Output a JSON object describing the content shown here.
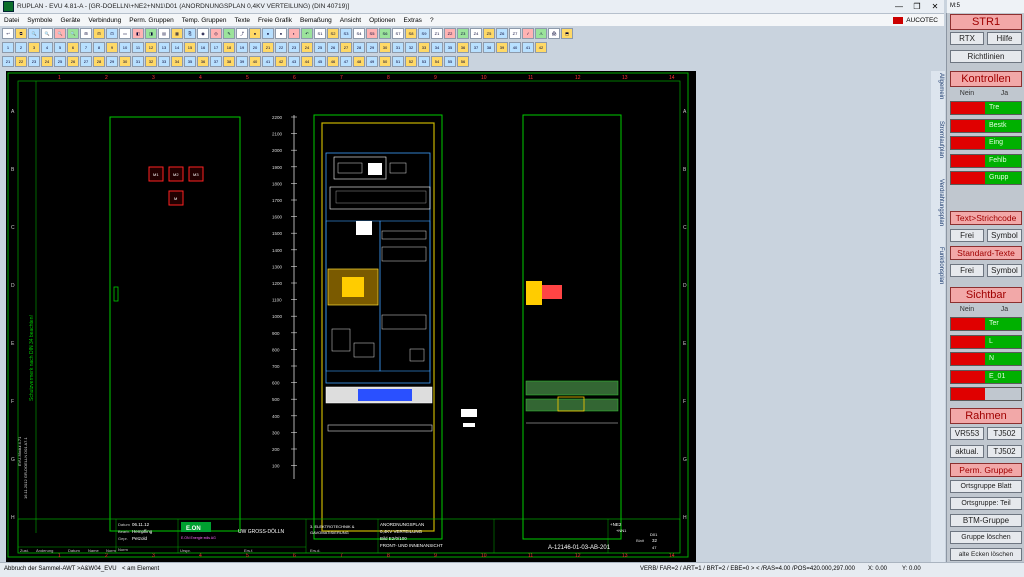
{
  "window": {
    "title": "RUPLAN - EVU 4.81-A - [GR-DOELLN\\+NE2+NN1\\D01 (ANORDNUNGSPLAN 0,4KV VERTEILUNG) (DIN 40719)]",
    "controls": [
      "—",
      "❐",
      "✕"
    ]
  },
  "menu": {
    "items": [
      "Datei",
      "Symbole",
      "Geräte",
      "Verbindung",
      "Perm. Gruppen",
      "Temp. Gruppen",
      "Texte",
      "Freie Grafik",
      "Bemaßung",
      "Ansicht",
      "Optionen",
      "Extras",
      "?"
    ],
    "brand": "AUCOTEC",
    "brand_color": "#cc0000"
  },
  "toolbar_rows": {
    "row1": [
      "↩",
      "⧉",
      "🔍",
      "🔍",
      "🔍",
      "🔍",
      "⊞",
      "⊟",
      "⊡",
      "▭",
      "◧",
      "◨",
      "▤",
      "▦",
      "⎘",
      "◉",
      "◎",
      "✎",
      "⤴",
      "●",
      "●",
      "●",
      "◐",
      "↶",
      "S1",
      "S2",
      "S3",
      "S4",
      "S5",
      "S6",
      "S7",
      "S8",
      "S9",
      "Z1",
      "Z2",
      "Z3",
      "Z4",
      "Z5",
      "Z6",
      "Z7",
      "✓",
      "⚠",
      "🖨",
      "⬒"
    ],
    "row2": [
      "1",
      "2",
      "3",
      "4",
      "5",
      "6",
      "7",
      "8",
      "9",
      "10",
      "11",
      "12",
      "13",
      "14",
      "15",
      "16",
      "17",
      "18",
      "19",
      "20",
      "21",
      "22",
      "23",
      "24",
      "25",
      "26",
      "27",
      "28",
      "29",
      "30",
      "31",
      "32",
      "33",
      "34",
      "35",
      "36",
      "37",
      "38",
      "39",
      "40",
      "41",
      "42"
    ],
    "row3": [
      "21",
      "22",
      "23",
      "24",
      "25",
      "26",
      "27",
      "28",
      "29",
      "30",
      "31",
      "32",
      "33",
      "34",
      "35",
      "36",
      "37",
      "38",
      "39",
      "40",
      "41",
      "42",
      "43",
      "44",
      "45",
      "46",
      "47",
      "48",
      "49",
      "50",
      "51",
      "52",
      "53",
      "54",
      "55",
      "56"
    ],
    "row4": [
      "1",
      "2",
      "3",
      "4",
      "5",
      "6",
      "7",
      "8",
      "9",
      "10",
      "11",
      "12",
      "13",
      "14",
      "15",
      "16",
      "17",
      "18",
      "19",
      "20",
      "21",
      "22",
      "23",
      "24",
      "25",
      "26",
      "27",
      "28",
      "29",
      "30",
      "31",
      "32",
      "33",
      "34",
      "35",
      "36",
      "37"
    ]
  },
  "drawing": {
    "background": "#000000",
    "frame_color": "#00aa00",
    "column_labels": [
      "1",
      "2",
      "3",
      "4",
      "5",
      "6",
      "7",
      "8",
      "9",
      "10",
      "11",
      "12",
      "13",
      "14"
    ],
    "row_labels": [
      "A",
      "B",
      "C",
      "D",
      "E",
      "F",
      "G",
      "H"
    ],
    "scale_labels": [
      "2200",
      "2100",
      "2000",
      "1900",
      "1800",
      "1700",
      "1600",
      "1500",
      "1400",
      "1300",
      "1200",
      "1100",
      "1000",
      "900",
      "800",
      "700",
      "600",
      "500",
      "400",
      "300",
      "200",
      "100"
    ],
    "left_vertical_text": "Schutzvermerk nach DIN 34 beachten!",
    "left_small_text": "EVU-Modul 4.71",
    "left_date_text": "16.11.2012 GR-DOELLN D01 A7.1",
    "device_labels": [
      "M1",
      "M2",
      "M3",
      "M"
    ],
    "title_block": {
      "datum_label": "Datum",
      "datum_value": "06.11.12",
      "bearb_label": "Bearb.",
      "bearb_value": "Hempfling",
      "gepr_label": "Gepr.",
      "gepr_value": "Petzold",
      "norm_label": "Norm",
      "company_logo": "E.ON",
      "company_sub": "E.ON Energie edis AG",
      "project": "UW GROSS-DÖLLN",
      "dept_line1": "3. ELEKTROTECHNIK &",
      "dept_line2": "GAVOMATISIERUNG",
      "doc_line1": "ANORDNUNGSPLAN",
      "doc_line2": "0,4KV VERTEILUNG",
      "doc_line3": "Bild E2/0/100",
      "doc_line4": "FRONT- UND INNENANSICHT",
      "ref1": "+NE2",
      "ref2": "+NN1",
      "ref3": "D01",
      "sheet_label": "Blatt",
      "sheet_value": "32",
      "sheets": "47",
      "drawing_no": "A-12146-01-03-AB-201",
      "zust": "Zust.",
      "aenderung": "Änderung",
      "datum": "Datum",
      "name": "Name",
      "norm": "Norm",
      "urspr": "Urspr.",
      "ers_f": "Ers.f.",
      "ers_d": "Ers.d."
    }
  },
  "side_tabs": [
    "Allgemein",
    "Stromlaufplan",
    "Verdrahtungsplan",
    "Funktionsplan"
  ],
  "right_panel": {
    "window_label": "M:5",
    "title": "STR1",
    "btn_rtx": "RTX",
    "btn_hilfe": "Hilfe",
    "btn_richtlinien": "Richtlinien",
    "kontrollen": "Kontrollen",
    "nein": "Nein",
    "ja": "Ja",
    "kontrollen_items": [
      "Tre",
      "Bestk",
      "Eing",
      "Fehlb",
      "Grupp"
    ],
    "text_strichcode": "Text>Strichcode",
    "frei": "Frei",
    "symbol": "Symbol",
    "standard_texte": "Standard-Texte",
    "sichtbar": "Sichtbar",
    "sichtbar_items": [
      "Ter",
      "L",
      "N",
      "E_01",
      ""
    ],
    "rahmen": "Rahmen",
    "vr553": "VR553",
    "tj502a": "TJ502",
    "aktual": "aktual.",
    "tj502b": "TJ502",
    "perm_gruppe": "Perm. Gruppe",
    "ortsgruppe_blatt": "Ortsgruppe Blatt",
    "ortsgruppe_teil": "Ortsgruppe: Teil",
    "btm_gruppe": "BTM-Gruppe",
    "gruppe_loeschen": "Gruppe löschen",
    "alte_ecken": "alte Ecken löschen"
  },
  "statusbar": {
    "left": "Abbruch der Sammel-AWT >A&W04_EVU",
    "middle": "< am Element",
    "right": "VERB/ FAR=2 / ART=1 / BRT=2 / EBE=0   > < /RAS=4.00 /POS=420.000,297.000",
    "x": "X: 0.00",
    "y": "Y: 0.00"
  }
}
